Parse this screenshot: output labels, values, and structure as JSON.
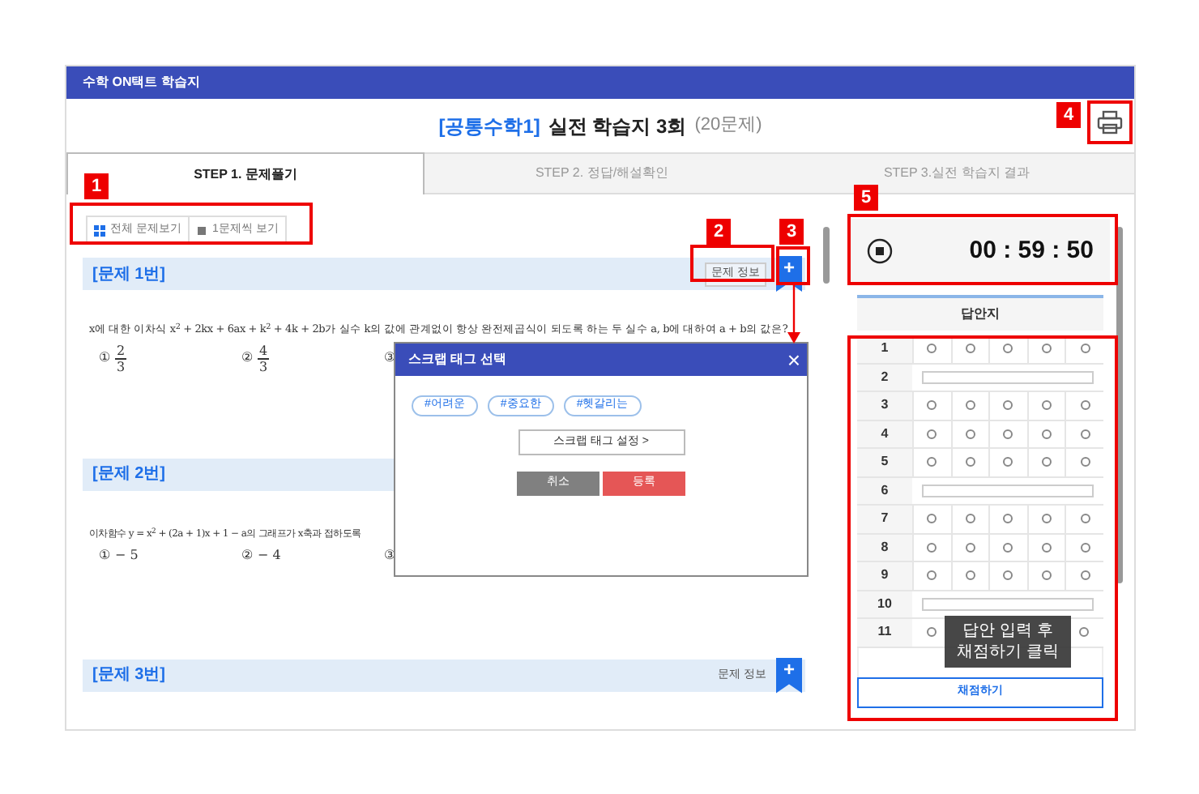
{
  "header": {
    "title": "수학 ON택트 학습지"
  },
  "page_title": {
    "subject": "[공통수학1]",
    "name": "실전 학습지 3회",
    "count": "(20문제)"
  },
  "tabs": [
    {
      "label": "STEP 1. 문제풀기",
      "selected": true
    },
    {
      "label": "STEP 2. 정답/해설확인",
      "selected": false
    },
    {
      "label": "STEP 3.실전 학습지 결과",
      "selected": false
    }
  ],
  "view_toggle": [
    {
      "label": "전체 문제보기",
      "selected": true
    },
    {
      "label": "1문제씩 보기",
      "selected": false
    }
  ],
  "questions": [
    {
      "title": "[문제 1번]",
      "info": "문제 정보",
      "add": "+",
      "text": "x에 대한 이차식 x$^{2}$ + 2kx + 6ax + k$^{2}$ + 4k + 2b가 실수 k의 값에 관계없이 항상 완전제곱식이 되도록 하는 두 실수 a, b에 대하여 a + b의 값은?",
      "options": [
        {
          "marker": "①",
          "num": "2",
          "den": "3"
        },
        {
          "marker": "②",
          "num": "4",
          "den": "3"
        },
        {
          "marker": "③"
        }
      ]
    },
    {
      "title": "[문제 2번]",
      "text": "이차함수 y = x$^{2}$ + (2a + 1)x + 1 − a의 그래프가 x축과 접하도록",
      "options": [
        {
          "marker": "①",
          "value": "− 5"
        },
        {
          "marker": "②",
          "value": "− 4"
        },
        {
          "marker": "③"
        }
      ]
    },
    {
      "title": "[문제 3번]",
      "info": "문제 정보",
      "add": "+"
    }
  ],
  "timer": {
    "time": "00 : 59 : 50"
  },
  "answer_sheet": {
    "title": "답안지",
    "rows": [
      {
        "number": "1",
        "kind": "choice",
        "choices": [
          {
            "selected": false
          },
          {
            "selected": false
          },
          {
            "selected": false
          },
          {
            "selected": false
          },
          {
            "selected": false
          }
        ]
      },
      {
        "number": "2",
        "kind": "text"
      },
      {
        "number": "3",
        "kind": "choice",
        "choices": [
          {
            "selected": false
          },
          {
            "selected": false
          },
          {
            "selected": false
          },
          {
            "selected": false
          },
          {
            "selected": false
          }
        ]
      },
      {
        "number": "4",
        "kind": "choice",
        "choices": [
          {
            "selected": false
          },
          {
            "selected": false
          },
          {
            "selected": false
          },
          {
            "selected": false
          },
          {
            "selected": false
          }
        ]
      },
      {
        "number": "5",
        "kind": "choice",
        "choices": [
          {
            "selected": false
          },
          {
            "selected": false
          },
          {
            "selected": false
          },
          {
            "selected": false
          },
          {
            "selected": false
          }
        ]
      },
      {
        "number": "6",
        "kind": "text"
      },
      {
        "number": "7",
        "kind": "choice",
        "choices": [
          {
            "selected": false
          },
          {
            "selected": false
          },
          {
            "selected": false
          },
          {
            "selected": false
          },
          {
            "selected": false
          }
        ]
      },
      {
        "number": "8",
        "kind": "choice",
        "choices": [
          {
            "selected": false
          },
          {
            "selected": false
          },
          {
            "selected": false
          },
          {
            "selected": false
          },
          {
            "selected": false
          }
        ]
      },
      {
        "number": "9",
        "kind": "choice",
        "choices": [
          {
            "selected": false
          },
          {
            "selected": false
          },
          {
            "selected": false
          },
          {
            "selected": false
          },
          {
            "selected": false
          }
        ]
      },
      {
        "number": "10",
        "kind": "text"
      },
      {
        "number": "11",
        "kind": "covered",
        "choices": [
          {
            "selected": false
          },
          {
            "selected": false
          }
        ]
      }
    ],
    "submit": "채점하기"
  },
  "tooltip": {
    "lines": [
      "답안 입력 후",
      "채점하기 클릭"
    ]
  },
  "popup": {
    "title": "스크랩 태그 선택",
    "close": "×",
    "tags": [
      "#어려운",
      "#중요한",
      "#헷갈리는"
    ],
    "settings": "스크랩 태그 설정 >",
    "cancel": "취소",
    "confirm": "등록"
  },
  "annotations": [
    {
      "label": "1"
    },
    {
      "label": "2"
    },
    {
      "label": "3"
    },
    {
      "label": "4"
    },
    {
      "label": "5"
    }
  ]
}
